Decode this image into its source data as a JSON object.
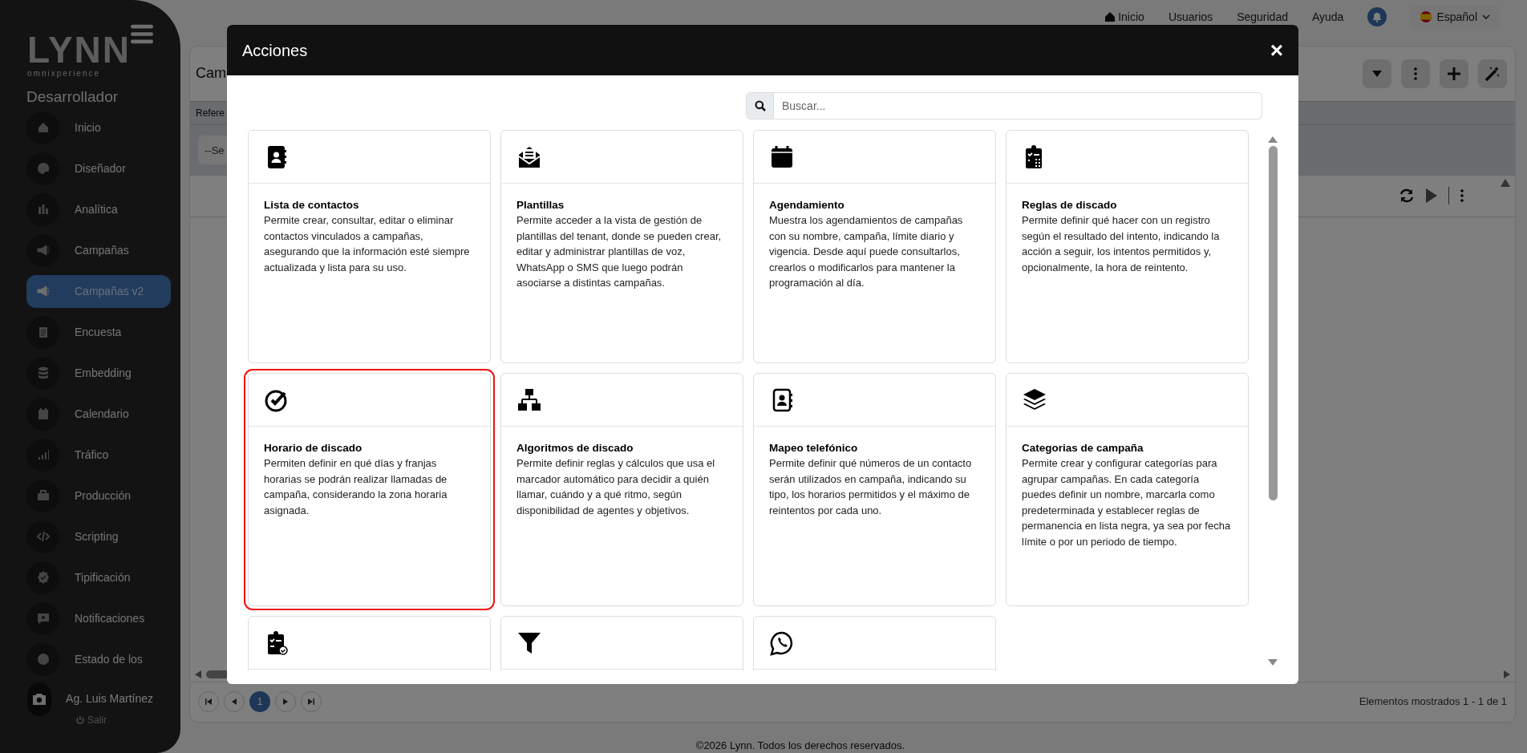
{
  "logo": {
    "name": "LYNN",
    "tagline": "omnixperience"
  },
  "sidebar": {
    "role": "Desarrollador",
    "items": [
      {
        "label": "Inicio",
        "selected": false
      },
      {
        "label": "Diseñador",
        "selected": false
      },
      {
        "label": "Analítica",
        "selected": false
      },
      {
        "label": "Campañas",
        "selected": false
      },
      {
        "label": "Campañas v2",
        "selected": true
      },
      {
        "label": "Encuesta",
        "selected": false
      },
      {
        "label": "Embedding",
        "selected": false
      },
      {
        "label": "Calendario",
        "selected": false
      },
      {
        "label": "Tráfico",
        "selected": false
      },
      {
        "label": "Producción",
        "selected": false
      },
      {
        "label": "Scripting",
        "selected": false
      },
      {
        "label": "Tipificación",
        "selected": false
      },
      {
        "label": "Notificaciones",
        "selected": false
      },
      {
        "label": "Estado de los",
        "selected": false
      }
    ],
    "user": "Ag. Luis Martínez",
    "logout": "Salir"
  },
  "top_nav": {
    "links": [
      "Inicio",
      "Usuarios",
      "Seguridad",
      "Ayuda"
    ],
    "language": "Español"
  },
  "panel": {
    "title": "Cam",
    "column_1": "Refere",
    "select": "--Se",
    "pagination": {
      "pages": [
        {
          "label": "1",
          "selected": true
        }
      ]
    },
    "summary": "Elementos mostrados 1 - 1 de 1"
  },
  "footer": "©2026 Lynn. Todos los derechos reservados.",
  "modal": {
    "title": "Acciones",
    "close": "×",
    "search": {
      "placeholder": "Buscar..."
    },
    "cards": [
      {
        "title": "Lista de contactos",
        "description": "Permite crear, consultar, editar o eliminar contactos vinculados a campañas, asegurando que la información esté siempre actualizada y lista para su uso.",
        "selected": false
      },
      {
        "title": "Plantillas",
        "description": "Permite acceder a la vista de gestión de plantillas del tenant, donde se pueden crear, editar y administrar plantillas de voz, WhatsApp o SMS que luego podrán asociarse a distintas campañas.",
        "selected": false
      },
      {
        "title": "Agendamiento",
        "description": "Muestra los agendamientos de campañas con su nombre, campaña, límite diario y vigencia. Desde aquí puede consultarlos, crearlos o modificarlos para mantener la programación al día.",
        "selected": false
      },
      {
        "title": "Reglas de discado",
        "description": "Permite definir qué hacer con un registro según el resultado del intento, indicando la acción a seguir, los intentos permitidos y, opcionalmente, la hora de reintento.",
        "selected": false
      },
      {
        "title": "Horario de discado",
        "description": "Permiten definir en qué días y franjas horarias se podrán realizar llamadas de campaña, considerando la zona horaria asignada.",
        "selected": true
      },
      {
        "title": "Algoritmos de discado",
        "description": "Permite definir reglas y cálculos que usa el marcador automático para decidir a quién llamar, cuándo y a qué ritmo, según disponibilidad de agentes y objetivos.",
        "selected": false
      },
      {
        "title": "Mapeo telefónico",
        "description": "Permite definir qué números de un contacto serán utilizados en campaña, indicando su tipo, los horarios permitidos y el máximo de reintentos por cada uno.",
        "selected": false
      },
      {
        "title": "Categorias de campaña",
        "description": "Permite crear y configurar categorías para agrupar campañas. En cada categoría puedes definir un nombre, marcarla como predeterminada y establecer reglas de permanencia en lista negra, ya sea por fecha límite o por un periodo de tiempo.",
        "selected": false
      },
      {
        "selected": false
      },
      {
        "selected": false
      },
      {
        "selected": false
      }
    ]
  }
}
